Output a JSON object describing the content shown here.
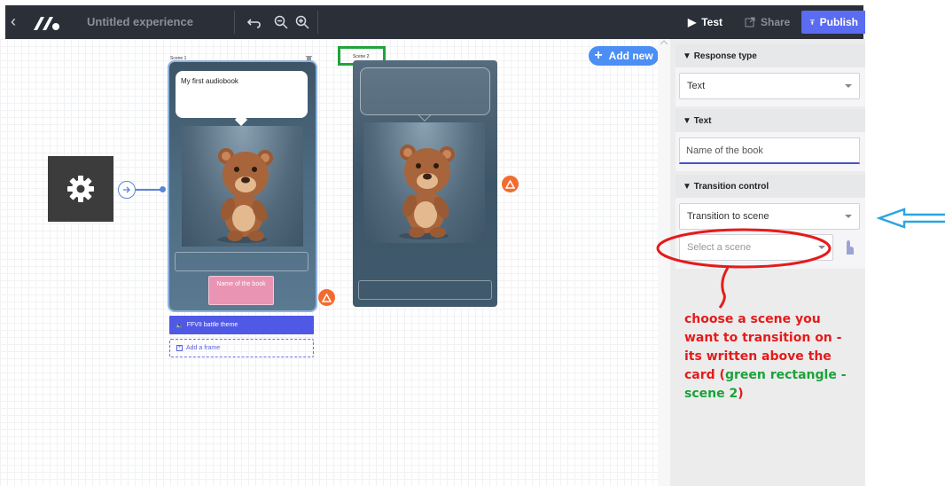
{
  "topbar": {
    "back_icon": "chevron-left-icon",
    "title": "Untitled experience",
    "test_label": "Test",
    "share_label": "Share",
    "publish_label": "Publish"
  },
  "canvas": {
    "add_new_label": "Add new",
    "scene1": {
      "label": "Scene 1",
      "bubble_text": "My first audiobook",
      "button_label": "Name of the book",
      "audio_label": "FFVII battle theme",
      "add_frame_label": "Add a frame"
    },
    "scene2": {
      "label": "Scene 2"
    }
  },
  "panel": {
    "response_type": {
      "header": "Response type",
      "value": "Text"
    },
    "text": {
      "header": "Text",
      "value": "Name of the book"
    },
    "transition": {
      "header": "Transition control",
      "value": "Transition to scene",
      "scene_placeholder": "Select a scene"
    }
  },
  "annotation": {
    "note_part1": "choose a scene you want to transition on - its written above the card (",
    "note_green": "green rectangle - scene 2",
    "note_part2": ")"
  },
  "colors": {
    "topbar": "#2b2f38",
    "publish": "#5a6cf2",
    "add_new": "#4b8ff5",
    "warning": "#f26c30",
    "audio_bar": "#5058e6",
    "annotation_red": "#e51b1b",
    "annotation_green": "#19a33a",
    "annotation_blue": "#2aa6e0"
  }
}
